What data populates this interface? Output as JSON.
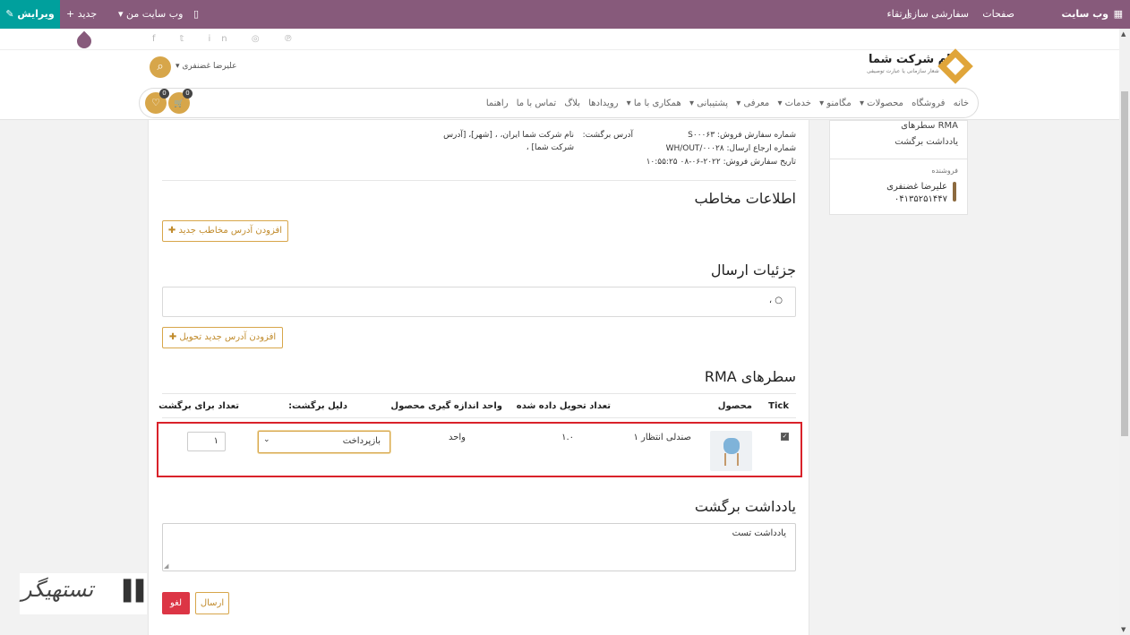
{
  "topbar": {
    "edit": "✎ ویرایش",
    "new": "+ جدید",
    "my_site": "▾ وب سایت من",
    "mobile_icon": "▯",
    "brand": "وب سایت",
    "apps_icon": "▦",
    "nav": [
      "صفحات",
      "سفارشی سازی",
      "ارتقاء"
    ]
  },
  "header": {
    "social_icons": "f 𝕥 in ◎ ℗",
    "user_name": "▾ علیرضا غضنفری",
    "search_icon": "⌕",
    "logo_name": "نام شرکت شما",
    "logo_slogan": "شعار سازمانی یا عبارت توصیفی",
    "menu": [
      "خانه",
      "فروشگاه",
      "محصولات ▾",
      "مگامنو ▾",
      "خدمات ▾",
      "معرفی ▾",
      "پشتیبانی ▾",
      "همکاری با ما ▾",
      "رویدادها",
      "بلاگ",
      "تماس با ما",
      "راهنما"
    ],
    "cart_count": "0",
    "wishlist_count": "0",
    "cart_icon": "🛒",
    "wishlist_icon": "♡"
  },
  "sidebar": {
    "links": [
      "سطرهای RMA",
      "یادداشت برگشت"
    ],
    "seller_label": "فروشنده",
    "seller_name": "علیرضا غضنفری",
    "seller_phone": "۰۴۱۳۵۲۵۱۴۴۷"
  },
  "order": {
    "sale_order": "شماره سفارش فروش: S۰۰۰۶۳",
    "delivery": "شماره ارجاع ارسال: WH/OUT/۰۰۰۲۸",
    "date": "تاریخ سفارش فروش: ۲۰۲۲-۰۶-۰۸ ۱۰:۵۵:۲۵",
    "return_label": "آدرس برگشت:",
    "return_address_1": "نام شرکت شما ایران، ، [شهر]، [آدرس",
    "return_address_2": "شرکت شما] ،"
  },
  "contact": {
    "title": "اطلاعات مخاطب",
    "add_btn": "✚ افزودن آدرس مخاطب جدید"
  },
  "shipping": {
    "title": "جزئیات ارسال",
    "address_value": "○ ،",
    "add_btn": "✚ افزودن آدرس جدید تحویل"
  },
  "rma": {
    "title": "سطرهای RMA",
    "headers": {
      "tick": "Tick",
      "product": "محصول",
      "delivered_qty": "تعداد تحویل داده شده",
      "uom": "واحد اندازه گیری محصول",
      "reason": "دلیل برگشت:",
      "return_qty": "تعداد برای برگشت"
    },
    "row": {
      "checked": "✓",
      "product": "صندلی انتظار ۱",
      "delivered_qty": "۱.۰",
      "uom": "واحد",
      "reason": "بازپرداخت",
      "return_qty": "۱"
    }
  },
  "note": {
    "title": "یادداشت برگشت",
    "value": "یادداشت تست"
  },
  "actions": {
    "cancel": "لغو",
    "send": "ارسال"
  },
  "watermark": {
    "text": "تستهیگر",
    "mark": "▌▌"
  }
}
